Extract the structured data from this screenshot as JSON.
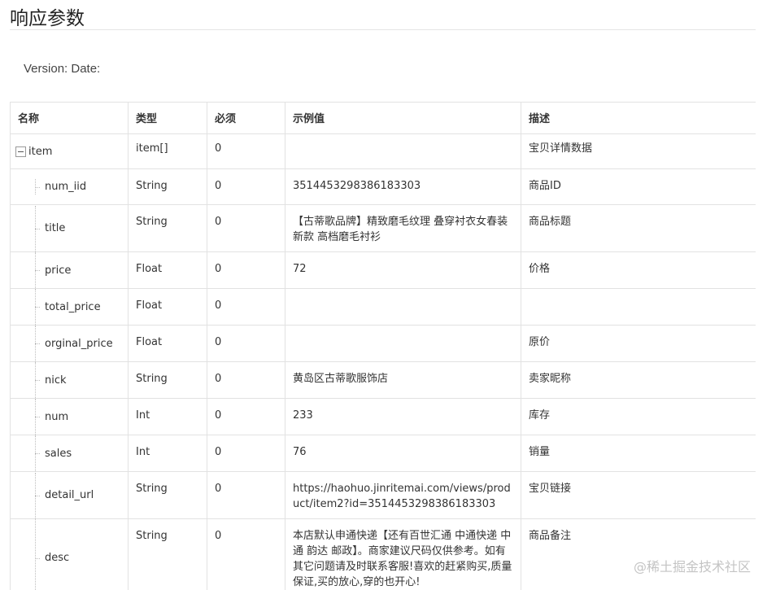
{
  "page": {
    "title": "响应参数",
    "version_line": "Version: Date:",
    "watermark": "@稀土掘金技术社区"
  },
  "table": {
    "headers": [
      "名称",
      "类型",
      "必须",
      "示例值",
      "描述"
    ],
    "root": {
      "name": "item",
      "type": "item[]",
      "required": "0",
      "example": "",
      "desc": "宝贝详情数据"
    },
    "rows": [
      {
        "name": "num_iid",
        "type": "String",
        "required": "0",
        "example": "3514453298386183303",
        "desc": "商品ID"
      },
      {
        "name": "title",
        "type": "String",
        "required": "0",
        "example": "【古蒂歌品牌】精致磨毛纹理 叠穿衬衣女春装新款 高档磨毛衬衫",
        "desc": "商品标题"
      },
      {
        "name": "price",
        "type": "Float",
        "required": "0",
        "example": "72",
        "desc": "价格"
      },
      {
        "name": "total_price",
        "type": "Float",
        "required": "0",
        "example": "",
        "desc": ""
      },
      {
        "name": "orginal_price",
        "type": "Float",
        "required": "0",
        "example": "",
        "desc": "原价"
      },
      {
        "name": "nick",
        "type": "String",
        "required": "0",
        "example": "黄岛区古蒂歌服饰店",
        "desc": "卖家昵称"
      },
      {
        "name": "num",
        "type": "Int",
        "required": "0",
        "example": "233",
        "desc": "库存"
      },
      {
        "name": "sales",
        "type": "Int",
        "required": "0",
        "example": "76",
        "desc": "销量"
      },
      {
        "name": "detail_url",
        "type": "String",
        "required": "0",
        "example": "https://haohuo.jinritemai.com/views/product/item2?id=3514453298386183303",
        "desc": "宝贝链接"
      },
      {
        "name": "desc",
        "type": "String",
        "required": "0",
        "example": "本店默认申通快递【还有百世汇通 中通快递 中通 韵达 邮政】。商家建议尺码仅供参考。如有其它问题请及时联系客服!喜欢的赶紧购买,质量保证,买的放心,穿的也开心!",
        "desc": "商品备注"
      }
    ]
  }
}
